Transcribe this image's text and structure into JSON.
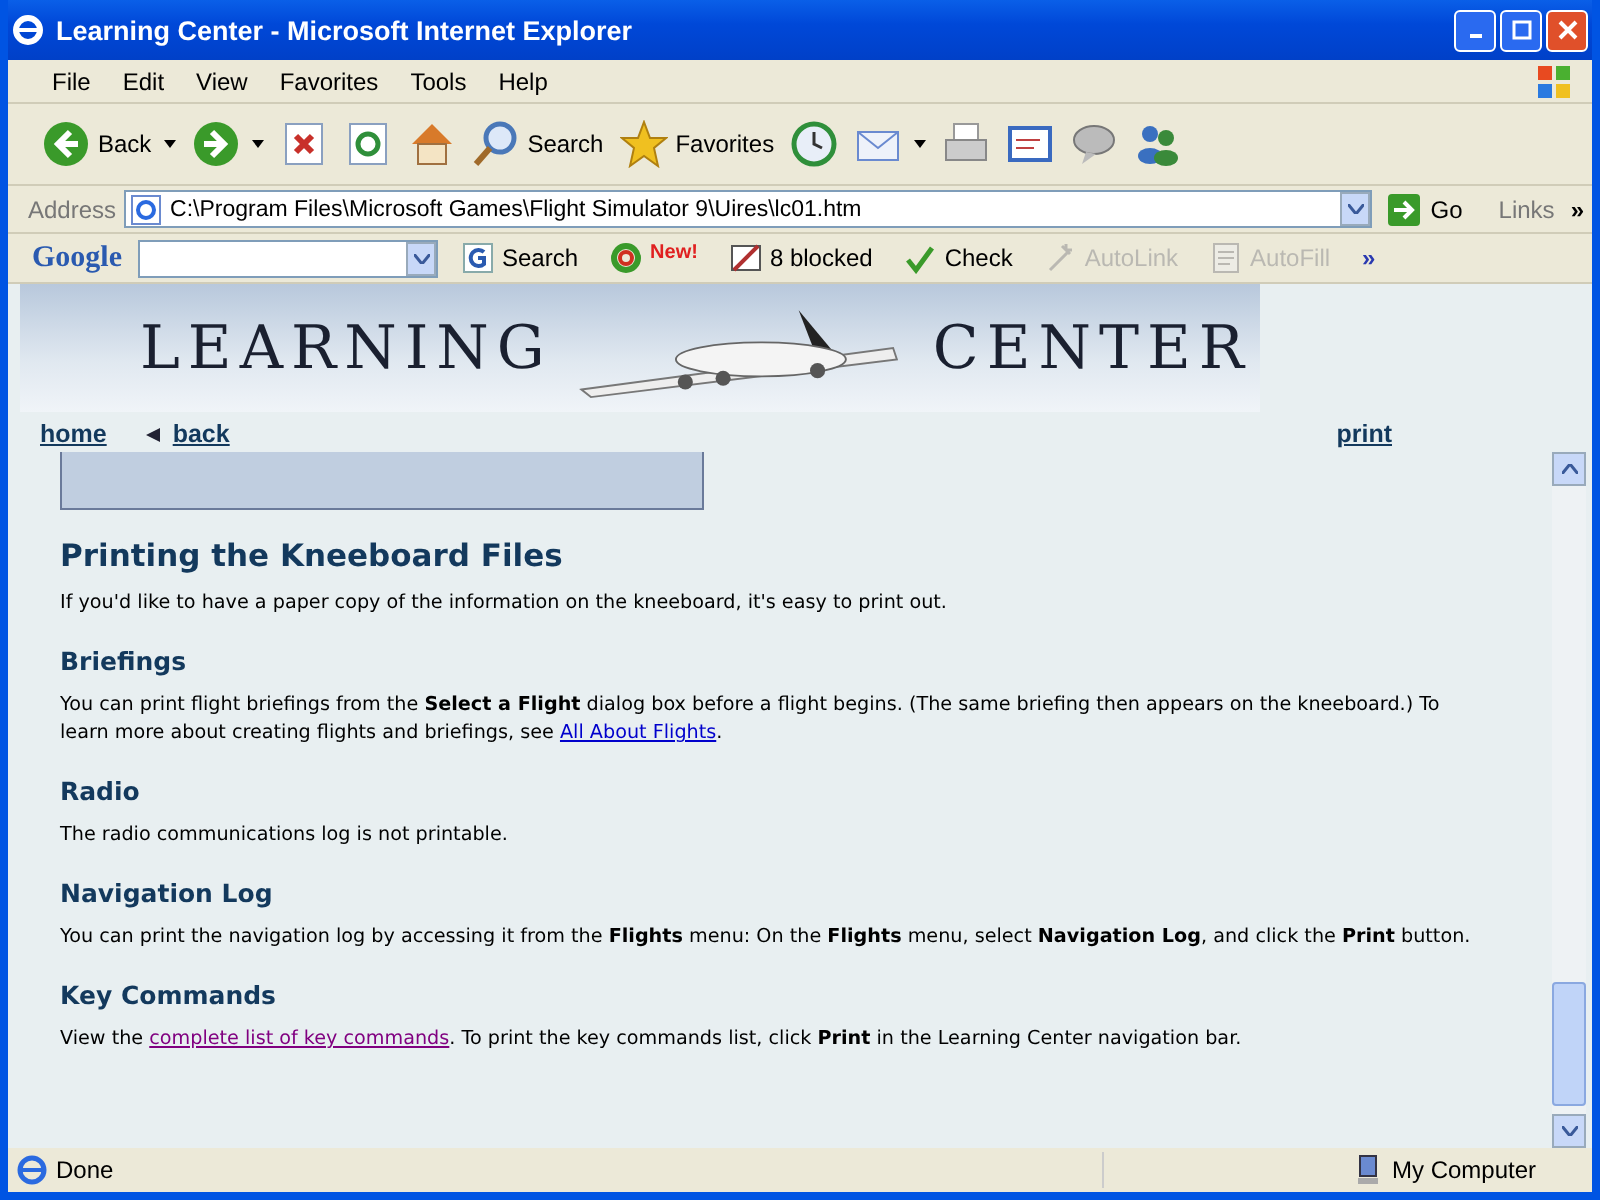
{
  "window": {
    "title": "Learning Center - Microsoft Internet Explorer"
  },
  "menu": [
    "File",
    "Edit",
    "View",
    "Favorites",
    "Tools",
    "Help"
  ],
  "toolbar": [
    {
      "kind": "back",
      "label": "Back",
      "dropdown": true
    },
    {
      "kind": "forward",
      "dropdown": true
    },
    {
      "kind": "stop",
      "dropdown": false
    },
    {
      "kind": "refresh",
      "dropdown": false
    },
    {
      "kind": "home",
      "dropdown": false
    },
    {
      "kind": "search",
      "label": "Search",
      "dropdown": false
    },
    {
      "kind": "favorites",
      "label": "Favorites",
      "dropdown": false
    },
    {
      "kind": "history",
      "dropdown": false
    },
    {
      "kind": "mail",
      "dropdown": true
    },
    {
      "kind": "print",
      "dropdown": false
    },
    {
      "kind": "edit",
      "dropdown": false
    },
    {
      "kind": "discuss",
      "dropdown": false
    },
    {
      "kind": "messenger",
      "dropdown": false
    }
  ],
  "address": {
    "label": "Address",
    "value": "C:\\Program Files\\Microsoft Games\\Flight Simulator 9\\Uires\\lc01.htm",
    "go": "Go",
    "links": "Links",
    "more": "»"
  },
  "google_bar": {
    "logo": "Google",
    "items": [
      {
        "kind": "search",
        "label": "Search",
        "disabled": false
      },
      {
        "kind": "new",
        "label": "New!",
        "disabled": false
      },
      {
        "kind": "blocked",
        "label": "8 blocked",
        "disabled": false
      },
      {
        "kind": "check",
        "label": "Check",
        "disabled": false
      },
      {
        "kind": "autolink",
        "label": "AutoLink",
        "disabled": true
      },
      {
        "kind": "autofill",
        "label": "AutoFill",
        "disabled": true
      }
    ],
    "more": "»"
  },
  "banner": {
    "left": "LEARNING",
    "right": "CENTER"
  },
  "nav": {
    "home": "home",
    "back": "back",
    "print": "print"
  },
  "sections": [
    {
      "kind": "title",
      "heading": "Printing the Kneeboard Files",
      "parts": [
        {
          "kind": "text",
          "text": "If you'd like to have a paper copy of the information on the kneeboard, it's easy to print out."
        }
      ]
    },
    {
      "kind": "heading",
      "heading": "Briefings",
      "parts": [
        {
          "kind": "text",
          "text": "You can print flight briefings from the **Select a Flight** dialog box before a flight begins. (The same briefing then appears on the kneeboard.) To learn more about creating flights and briefings, see "
        },
        {
          "kind": "link",
          "text": "All About Flights",
          "visited": false
        },
        {
          "kind": "text",
          "text": "."
        }
      ]
    },
    {
      "kind": "heading",
      "heading": "Radio",
      "parts": [
        {
          "kind": "text",
          "text": "The radio communications log is not printable."
        }
      ]
    },
    {
      "kind": "heading",
      "heading": "Navigation Log",
      "parts": [
        {
          "kind": "text",
          "text": "You can print the navigation log by accessing it from the **Flights** menu: On the **Flights** menu, select **Navigation Log**, and click the **Print** button."
        }
      ]
    },
    {
      "kind": "heading",
      "heading": "Key Commands",
      "parts": [
        {
          "kind": "text",
          "text": "View the "
        },
        {
          "kind": "link",
          "text": "complete list of key commands",
          "visited": true
        },
        {
          "kind": "text",
          "text": ". To print the key commands list, click **Print** in the Learning Center navigation bar."
        }
      ]
    }
  ],
  "status_bar": {
    "text": "Done",
    "zone": "My Computer"
  }
}
